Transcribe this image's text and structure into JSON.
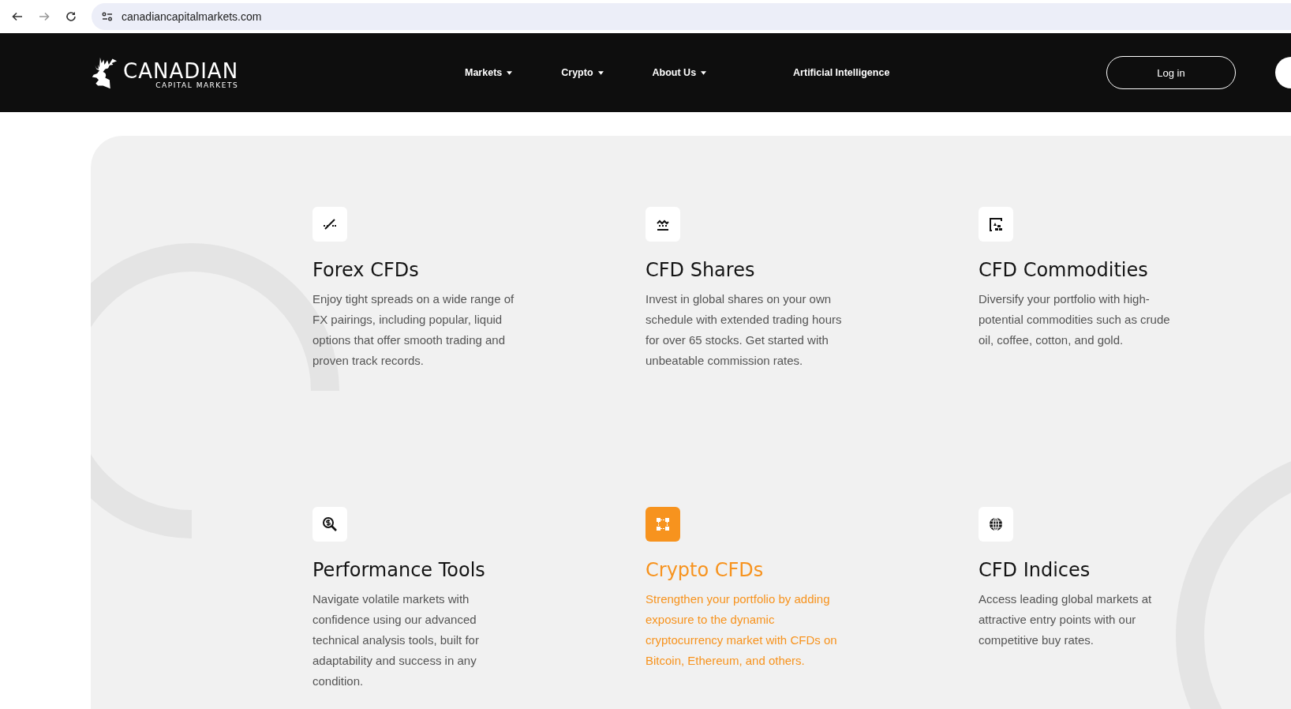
{
  "browser": {
    "url": "canadiancapitalmarkets.com"
  },
  "header": {
    "logo": {
      "name": "CANADIAN",
      "tagline": "CAPITAL MARKETS"
    },
    "nav": [
      {
        "label": "Markets",
        "dropdown": true
      },
      {
        "label": "Crypto",
        "dropdown": true
      },
      {
        "label": "About Us",
        "dropdown": true
      },
      {
        "label": "Artificial Intelligence",
        "dropdown": false
      }
    ],
    "login": "Log in"
  },
  "cards": [
    {
      "title": "Forex CFDs",
      "text": "Enjoy tight spreads on a wide range of FX pairings, including popular, liquid options that offer smooth trading and proven track records.",
      "selected": false
    },
    {
      "title": "CFD Shares",
      "text": "Invest in global shares on your own schedule with extended trading hours for over 65 stocks. Get started with unbeatable commission rates.",
      "selected": false
    },
    {
      "title": "CFD Commodities",
      "text": "Diversify your portfolio with high-potential commodities such as crude oil, coffee, cotton, and gold.",
      "selected": false
    },
    {
      "title": "Performance Tools",
      "text": "Navigate volatile markets with confidence using our advanced technical analysis tools, built for adaptability and success in any condition.",
      "selected": false
    },
    {
      "title": "Crypto CFDs",
      "text": "Strengthen your portfolio by adding exposure to the dynamic cryptocurrency market with CFDs on Bitcoin, Ethereum, and others.",
      "selected": true
    },
    {
      "title": "CFD Indices",
      "text": "Access leading global markets at attractive entry points with our competitive buy rates.",
      "selected": false
    }
  ]
}
